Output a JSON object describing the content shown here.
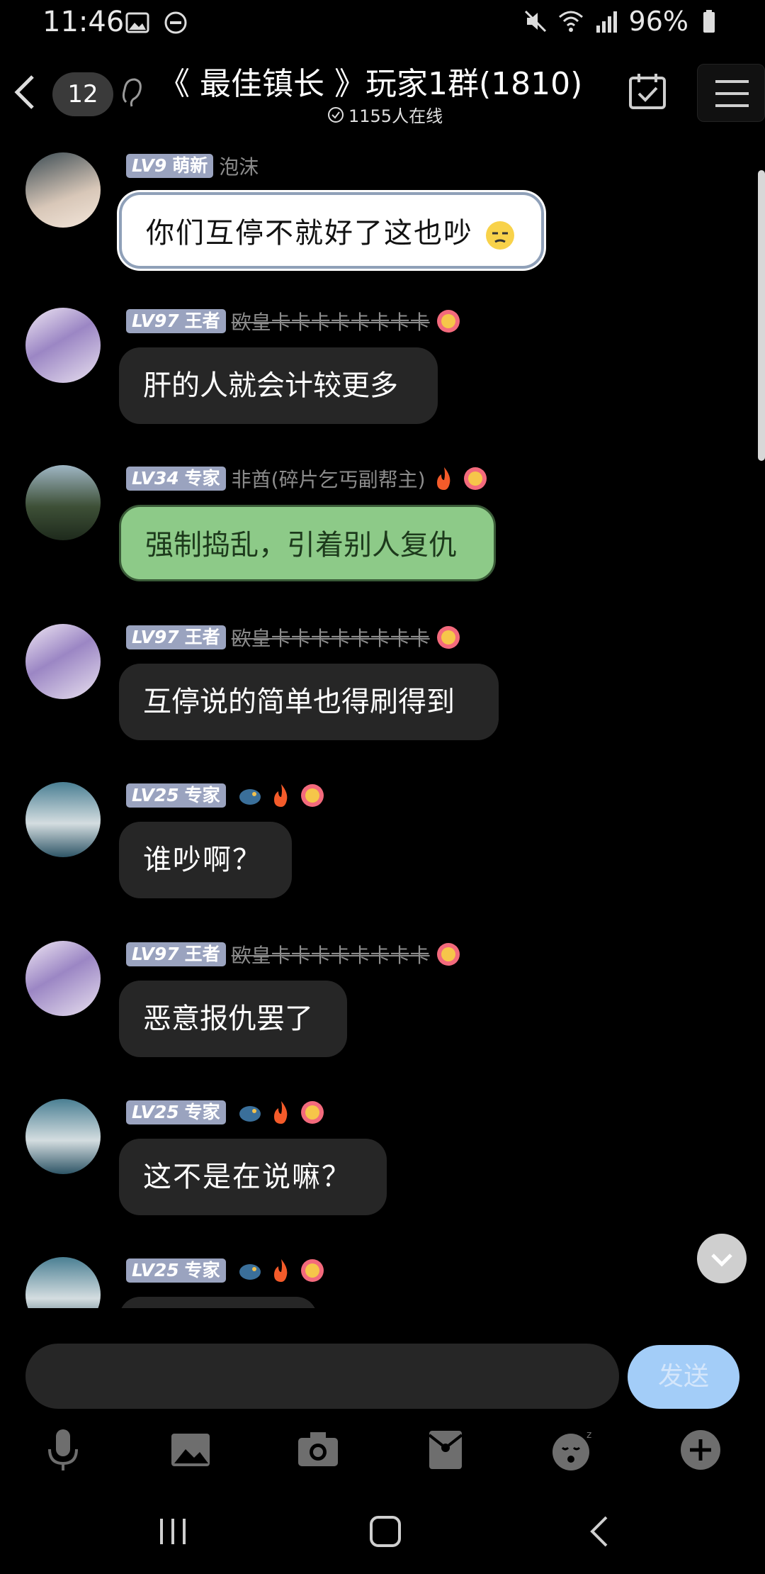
{
  "status_bar": {
    "time": "11:46",
    "battery": "96%"
  },
  "header": {
    "unread_count": "12",
    "title": "《 最佳镇长 》玩家1群(1810)",
    "online": "1155人在线"
  },
  "messages": [
    {
      "level": "LV9",
      "rank": "萌新",
      "nick": "泡沫",
      "text": "你们互停不就好了这也吵",
      "style": "white"
    },
    {
      "level": "LV97",
      "rank": "王者",
      "nick": "欧皇卡卡卡卡卡卡卡卡",
      "text": "肝的人就会计较更多",
      "style": "dark"
    },
    {
      "level": "LV34",
      "rank": "专家",
      "nick": "非酋(碎片乞丐副帮主)",
      "text": "强制捣乱，引着别人复仇",
      "style": "green"
    },
    {
      "level": "LV97",
      "rank": "王者",
      "nick": "欧皇卡卡卡卡卡卡卡卡",
      "text": "互停说的简单也得刷得到",
      "style": "dark"
    },
    {
      "level": "LV25",
      "rank": "专家",
      "nick": "",
      "text": "谁吵啊？",
      "style": "hand"
    },
    {
      "level": "LV97",
      "rank": "王者",
      "nick": "欧皇卡卡卡卡卡卡卡卡",
      "text": "恶意报仇罢了",
      "style": "dark"
    },
    {
      "level": "LV25",
      "rank": "专家",
      "nick": "",
      "text": "这不是在说嘛？",
      "style": "hand"
    },
    {
      "level": "LV25",
      "rank": "专家",
      "nick": "",
      "text": "",
      "style": "hand"
    }
  ],
  "input": {
    "placeholder": "",
    "send_label": "发送"
  },
  "colors": {
    "background": "#000000",
    "bubble_dark": "#262626",
    "bubble_green": "#8dca88",
    "level_badge": "#9aa3bf",
    "send_button": "#a3cdf8"
  }
}
